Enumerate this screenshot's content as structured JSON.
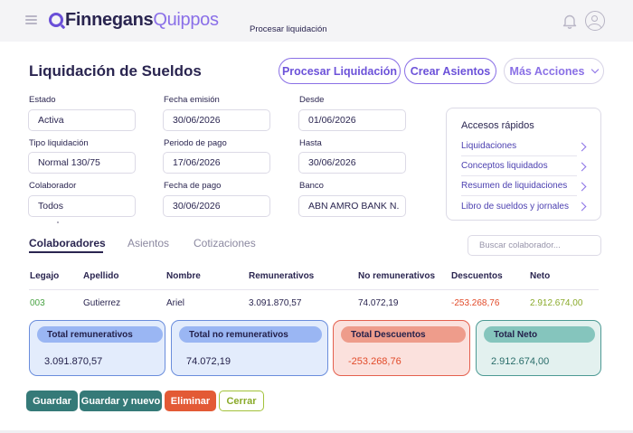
{
  "header": {
    "logo_primary": "Finnegans",
    "logo_secondary": "Quippos",
    "page_context": "Procesar liquidación"
  },
  "page": {
    "title": "Liquidación de Sueldos"
  },
  "actions": {
    "process": "Procesar Liquidación",
    "create_entries": "Crear Asientos",
    "more": "Más Acciones"
  },
  "filters": {
    "estado": {
      "label": "Estado",
      "value": "Activa"
    },
    "fecha_emision": {
      "label": "Fecha emisión",
      "value": "30/06/2026"
    },
    "desde": {
      "label": "Desde",
      "value": "01/06/2026"
    },
    "tipo": {
      "label": "Tipo liquidación",
      "value": "Normal 130/75"
    },
    "periodo": {
      "label": "Periodo de pago",
      "value": "17/06/2026"
    },
    "hasta": {
      "label": "Hasta",
      "value": "30/06/2026"
    },
    "colaborador": {
      "label": "Colaborador",
      "value": "Todos"
    },
    "fecha_pago": {
      "label": "Fecha de pago",
      "value": "30/06/2026"
    },
    "banco": {
      "label": "Banco",
      "value": "ABN AMRO BANK N."
    }
  },
  "quick_access": {
    "title": "Accesos rápidos",
    "items": [
      "Liquidaciones",
      "Conceptos liquidados",
      "Resumen de liquidaciones",
      "Libro de sueldos y jornales"
    ]
  },
  "tabs": [
    "Colaboradores",
    "Asientos",
    "Cotizaciones"
  ],
  "search": {
    "placeholder": "Buscar colaborador..."
  },
  "table": {
    "headers": [
      "Legajo",
      "Apellido",
      "Nombre",
      "Remunerativos",
      "No remunerativos",
      "Descuentos",
      "Neto"
    ],
    "rows": [
      [
        "003",
        "Gutierrez",
        "Ariel",
        "3.091.870,57",
        "74.072,19",
        "-253.268,76",
        "2.912.674,00"
      ]
    ]
  },
  "totals": [
    {
      "label": "Total remunerativos",
      "value": "3.091.870,57"
    },
    {
      "label": "Total no remunerativos",
      "value": "74.072,19"
    },
    {
      "label": "Total Descuentos",
      "value": "-253.268,76"
    },
    {
      "label": "Total Neto",
      "value": "2.912.674,00"
    }
  ],
  "footer_buttons": {
    "save": "Guardar",
    "save_new": "Guardar y nuevo",
    "delete": "Eliminar",
    "close": "Cerrar"
  },
  "colors": {
    "brand": "#6a4fd8",
    "navy": "#2a2550",
    "teal": "#357a78",
    "danger": "#e35a35",
    "lime": "#a3c23a"
  }
}
